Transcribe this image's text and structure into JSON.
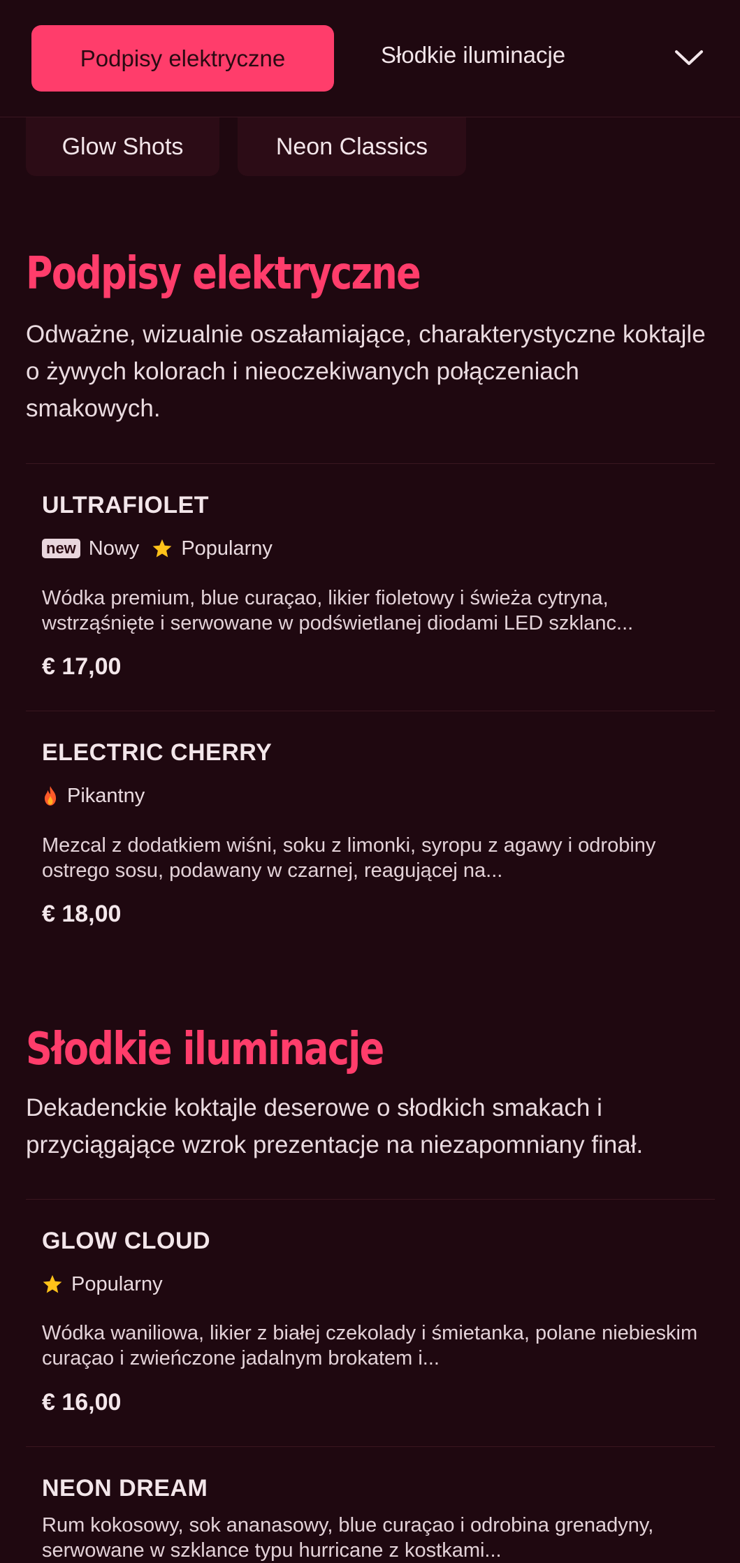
{
  "nav": {
    "active_tab": "Podpisy elektryczne",
    "tab_2": "Słodkie iluminacje",
    "pills": [
      "Glow Shots",
      "Neon Classics"
    ],
    "expand_icon": "chevron-down-icon"
  },
  "colors": {
    "background": "#1f0810",
    "accent": "#ff3d6b",
    "pill_bg": "#2c0c16",
    "star": "#ffc21a",
    "flame": "#ff5a2a"
  },
  "sections": [
    {
      "title": "Podpisy elektryczne",
      "description": "Odważne, wizualnie oszałamiające, charakterystyczne koktajle o żywych kolorach i nieoczekiwanych połączeniach smakowych.",
      "items": [
        {
          "name": "ULTRAFIOLET",
          "badge": "new",
          "tag_new": "Nowy",
          "tag_popular": "Popularny",
          "description": "Wódka premium, blue curaçao, likier fioletowy i świeża cytryna, wstrząśnięte i serwowane w podświetlanej diodami LED szklanc...",
          "price": "€ 17,00"
        },
        {
          "name": "ELECTRIC CHERRY",
          "tag_spicy": "Pikantny",
          "description": "Mezcal z dodatkiem wiśni, soku z limonki, syropu z agawy i odrobiny ostrego sosu, podawany w czarnej, reagującej na...",
          "price": "€ 18,00"
        }
      ]
    },
    {
      "title": "Słodkie iluminacje",
      "description": "Dekadenckie koktajle deserowe o słodkich smakach i przyciągające wzrok prezentacje na niezapomniany finał.",
      "items": [
        {
          "name": "GLOW CLOUD",
          "tag_popular": "Popularny",
          "description": "Wódka waniliowa, likier z białej czekolady i śmietanka, polane niebieskim curaçao i zwieńczone jadalnym brokatem i...",
          "price": "€ 16,00"
        },
        {
          "name": "NEON DREAM",
          "description": "Rum kokosowy, sok ananasowy, blue curaçao i odrobina grenadyny, serwowane w szklance typu hurricane z kostkami..."
        }
      ]
    }
  ]
}
